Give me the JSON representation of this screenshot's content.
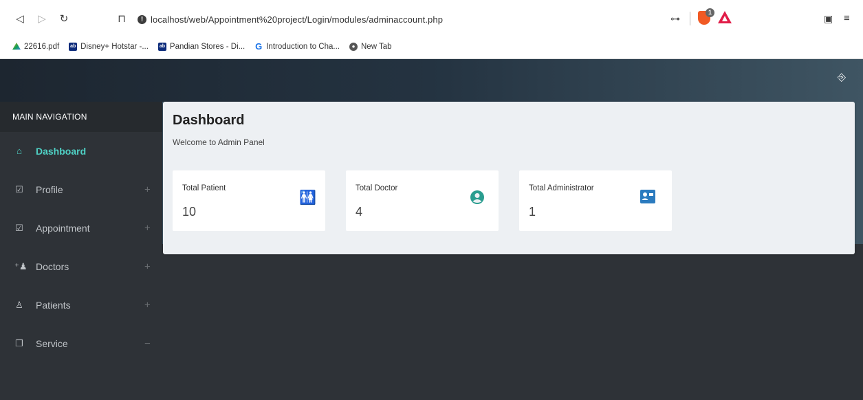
{
  "browser": {
    "url": "localhost/web/Appointment%20project/Login/modules/adminaccount.php",
    "brave_badge": "1",
    "bookmarks": [
      {
        "label": "22616.pdf",
        "icon": "google-drive-icon"
      },
      {
        "label": "Disney+ Hotstar -...",
        "icon": "hotstar-icon"
      },
      {
        "label": "Pandian Stores - Di...",
        "icon": "hotstar-icon"
      },
      {
        "label": "Introduction to Cha...",
        "icon": "g-icon"
      },
      {
        "label": "New Tab",
        "icon": "globe-icon"
      }
    ]
  },
  "sidebar": {
    "header": "MAIN NAVIGATION",
    "items": [
      {
        "label": "Dashboard",
        "icon": "home-icon",
        "expand": ""
      },
      {
        "label": "Profile",
        "icon": "calendar-check-icon",
        "expand": "+"
      },
      {
        "label": "Appointment",
        "icon": "calendar-check-icon",
        "expand": "+"
      },
      {
        "label": "Doctors",
        "icon": "user-plus-icon",
        "expand": "+"
      },
      {
        "label": "Patients",
        "icon": "user-icon",
        "expand": "+"
      },
      {
        "label": "Service",
        "icon": "copy-icon",
        "expand": "−"
      }
    ]
  },
  "main": {
    "title": "Dashboard",
    "subtitle": "Welcome to Admin Panel",
    "stats": [
      {
        "label": "Total Patient",
        "value": "10",
        "icon": "restroom-icon",
        "color": "#e85a6b"
      },
      {
        "label": "Total Doctor",
        "value": "4",
        "icon": "user-circle-icon",
        "color": "#2a9d8f"
      },
      {
        "label": "Total Administrator",
        "value": "1",
        "icon": "address-card-icon",
        "color": "#2b7bbf"
      }
    ]
  },
  "colors": {
    "active_nav": "#4fd1c5",
    "sidebar_bg": "#2e3237",
    "card_bg": "#edf0f3"
  }
}
